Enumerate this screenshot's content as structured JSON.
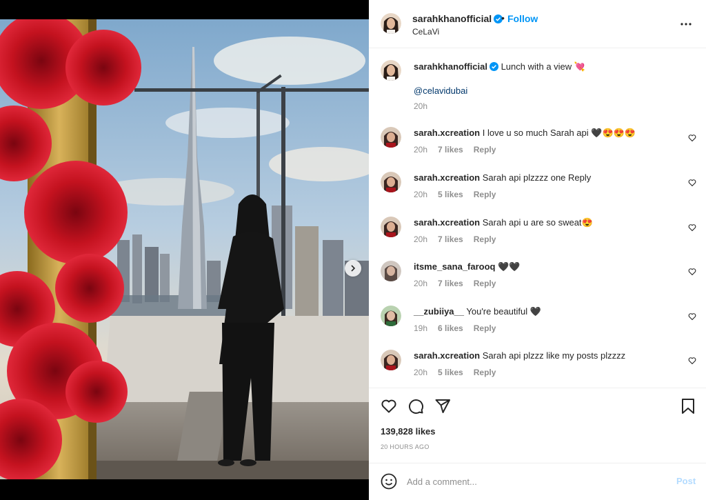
{
  "header": {
    "username": "sarahkhanofficial",
    "separator": "•",
    "follow_label": "Follow",
    "location": "CeLaVi",
    "more_icon": "more-horizontal-icon"
  },
  "caption": {
    "username": "sarahkhanofficial",
    "text": "Lunch with a view 💘",
    "mention": "@celavidubai",
    "time": "20h"
  },
  "comments": [
    {
      "username": "sarah.xcreation",
      "text": "I love u so much Sarah api 🖤😍😍😍",
      "time": "20h",
      "likes": "7 likes",
      "reply": "Reply"
    },
    {
      "username": "sarah.xcreation",
      "text": "Sarah api plzzzz one Reply",
      "time": "20h",
      "likes": "5 likes",
      "reply": "Reply"
    },
    {
      "username": "sarah.xcreation",
      "text": "Sarah api u are so sweat😍",
      "time": "20h",
      "likes": "7 likes",
      "reply": "Reply"
    },
    {
      "username": "itsme_sana_farooq",
      "text": "🖤🖤",
      "time": "20h",
      "likes": "7 likes",
      "reply": "Reply"
    },
    {
      "username": "__zubiiya__",
      "text": "You're beautiful 🖤",
      "time": "19h",
      "likes": "6 likes",
      "reply": "Reply"
    },
    {
      "username": "sarah.xcreation",
      "text": "Sarah api plzzz like my posts plzzzz",
      "time": "20h",
      "likes": "5 likes",
      "reply": "Reply"
    }
  ],
  "actions": {
    "likes": "139,828 likes",
    "posted": "20 HOURS AGO"
  },
  "add_comment": {
    "placeholder": "Add a comment...",
    "post_label": "Post"
  },
  "media": {
    "carousel_count": 2,
    "carousel_active": 1
  },
  "colors": {
    "accent": "#0095f6",
    "verified": "#0095f6",
    "muted": "#8e8e8e",
    "post_disabled": "#b3dbff"
  }
}
